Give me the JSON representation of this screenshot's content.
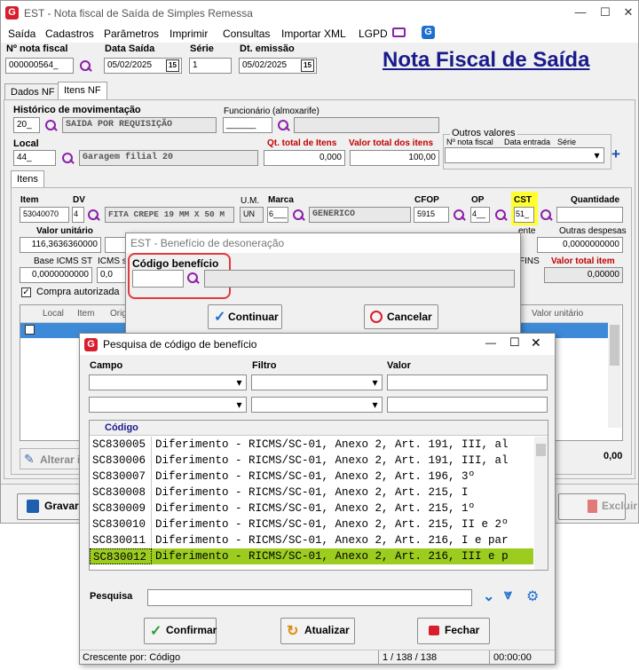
{
  "window": {
    "title": "EST - Nota fiscal de Saída de Simples Remessa",
    "heading": "Nota Fiscal de Saída"
  },
  "menu": [
    "Saída",
    "Cadastros",
    "Parâmetros",
    "Imprimir",
    "Consultas",
    "Importar XML",
    "LGPD"
  ],
  "header": {
    "nota_label": "Nº nota fiscal",
    "nota_value": "000000564_",
    "data_saida_label": "Data Saída",
    "data_saida_value": "05/02/2025",
    "serie_label": "Série",
    "serie_value": "1",
    "dt_emissao_label": "Dt. emissão",
    "dt_emissao_value": "05/02/2025",
    "cal_glyph": "15"
  },
  "tabs": [
    "Dados NF",
    "Itens NF"
  ],
  "itens_nf": {
    "historico_label": "Histórico de movimentação",
    "historico_code": "20_",
    "historico_desc": "SAIDA POR REQUISIÇÃO",
    "funcionario_label": "Funcionário (almoxarife)",
    "funcionario_value": "______",
    "local_label": "Local",
    "local_code": "44_",
    "local_desc": "Garagem filial 20",
    "qt_total_label": "Qt. total de Itens",
    "qt_total_value": "0,000",
    "valor_total_label": "Valor total dos itens",
    "valor_total_value": "100,00",
    "outros_valores_label": "Outros valores",
    "ov_nota": "Nº nota fiscal",
    "ov_data": "Data entrada",
    "ov_serie": "Série",
    "plus": "+"
  },
  "itens_tab": "Itens",
  "item_row": {
    "item_label": "Item",
    "item_value": "53040070",
    "dv_label": "DV",
    "dv_value": "4",
    "desc_value": "FITA CREPE 19 MM X 50 M",
    "um_label": "U.M.",
    "um_value": "UN",
    "marca_label": "Marca",
    "marca_code": "6___",
    "marca_desc": "GENERICO",
    "cfop_label": "CFOP",
    "cfop_value": "5915",
    "op_label": "OP",
    "op_value": "4__",
    "cst_label": "CST",
    "cst_value": "51_",
    "qtd_label": "Quantidade",
    "valor_unit_label": "Valor unitário",
    "valor_unit_value": "116,3636360000",
    "outras_despesas_label": "Outras despesas",
    "outras_despesas_value": "0,0000000000",
    "base_icms_st_label": "Base ICMS ST",
    "base_icms_st_value": "0,0000000000",
    "icms_st_label": "ICMS st",
    "icms_st_value": "0,0",
    "cofins_label": "FINS",
    "valor_total_item_label": "Valor total item",
    "valor_total_item_value": "0,00000",
    "compra_autorizada_label": "Compra autorizada",
    "cut_labels": [
      "ente"
    ]
  },
  "list_cols": [
    "Local",
    "Item",
    "Origi",
    "Valor unitário"
  ],
  "alterar_label": "Alterar i",
  "total_right": "0,00",
  "gravar_label": "Gravar",
  "excluir_label": "Excluir",
  "beneficio_dialog": {
    "title": "EST - Benefício de desoneração",
    "label": "Código benefício",
    "continuar": "Continuar",
    "cancelar": "Cancelar"
  },
  "pesquisa_dialog": {
    "title": "Pesquisa de código de benefício",
    "campo_label": "Campo",
    "filtro_label": "Filtro",
    "valor_label": "Valor",
    "grid_header": "Código",
    "rows": [
      {
        "code": "SC830005",
        "desc": "Diferimento - RICMS/SC-01, Anexo 2, Art. 191, III, al"
      },
      {
        "code": "SC830006",
        "desc": "Diferimento - RICMS/SC-01, Anexo 2, Art. 191, III, al"
      },
      {
        "code": "SC830007",
        "desc": "Diferimento - RICMS/SC-01, Anexo 2, Art. 196, 3º"
      },
      {
        "code": "SC830008",
        "desc": "Diferimento - RICMS/SC-01, Anexo 2, Art. 215, I"
      },
      {
        "code": "SC830009",
        "desc": "Diferimento - RICMS/SC-01, Anexo 2, Art. 215, 1º"
      },
      {
        "code": "SC830010",
        "desc": "Diferimento - RICMS/SC-01, Anexo 2, Art. 215, II e 2º"
      },
      {
        "code": "SC830011",
        "desc": "Diferimento - RICMS/SC-01, Anexo 2, Art. 216, I e par"
      },
      {
        "code": "SC830012",
        "desc": "Diferimento - RICMS/SC-01, Anexo 2, Art. 216, III e p"
      }
    ],
    "pesquisa_label": "Pesquisa",
    "confirmar": "Confirmar",
    "atualizar": "Atualizar",
    "fechar": "Fechar",
    "status_order": "Crescente por: Código",
    "status_count": "1 / 138 / 138",
    "status_time": "00:00:00"
  },
  "colors": {
    "accent_purple": "#8b1fa8",
    "selection": "#9ccc1e",
    "cst_highlight": "#ffff33",
    "title_blue": "#1a1a8c"
  }
}
